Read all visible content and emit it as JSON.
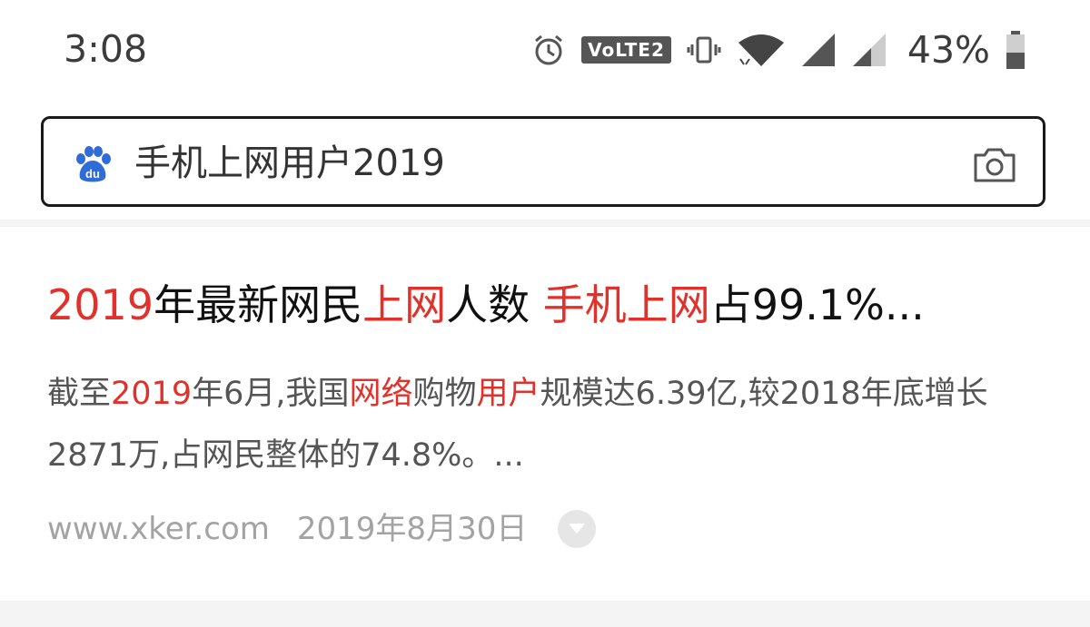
{
  "status_bar": {
    "time": "3:08",
    "volte_label": "VoLTE2",
    "battery_percent": "43%",
    "icons": [
      "alarm-icon",
      "volte-icon",
      "vibrate-icon",
      "wifi-icon",
      "signal-icon",
      "signal-icon",
      "battery-icon"
    ]
  },
  "search": {
    "query": "手机上网用户2019",
    "logo_text": "du",
    "icons": [
      "baidu-paw-icon",
      "camera-icon"
    ]
  },
  "result": {
    "title_parts": [
      {
        "text": "2019",
        "hl": true
      },
      {
        "text": "年最新网民",
        "hl": false
      },
      {
        "text": "上网",
        "hl": true
      },
      {
        "text": "人数 ",
        "hl": false
      },
      {
        "text": "手机上网",
        "hl": true
      },
      {
        "text": "占99.1%...",
        "hl": false
      }
    ],
    "abstract_parts": [
      {
        "text": "截至",
        "hl": false
      },
      {
        "text": "2019",
        "hl": true
      },
      {
        "text": "年6月,我国",
        "hl": false
      },
      {
        "text": "网络",
        "hl": true
      },
      {
        "text": "购物",
        "hl": false
      },
      {
        "text": "用户",
        "hl": true
      },
      {
        "text": "规模达6.39亿,较2018年底增长2871万,占网民整体的74.8%。...",
        "hl": false
      }
    ],
    "source": "www.xker.com",
    "date": "2019年8月30日",
    "more_icon": "chevron-down-icon"
  },
  "colors": {
    "highlight": "#e0312b",
    "baidu_blue": "#2f6bd9",
    "meta_gray": "#a3a3a3"
  }
}
